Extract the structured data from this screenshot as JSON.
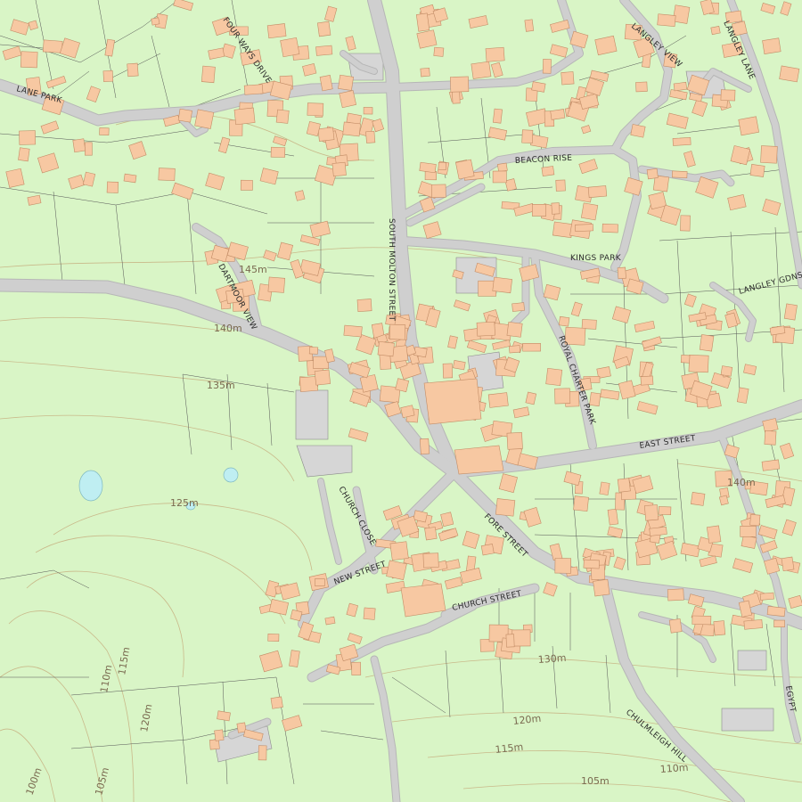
{
  "colors": {
    "land": "#d9f5c6",
    "road": "#cfcfcf",
    "building": "#f7c8a2",
    "building_outline": "#c28c66",
    "contour": "#c9b98a",
    "water": "#bfeef2",
    "grey_area": "#d6d6d6"
  },
  "road_labels": [
    {
      "id": "four-ways-drive",
      "text": "FOUR WAYS DRIVE"
    },
    {
      "id": "langley-view",
      "text": "LANGLEY VIEW"
    },
    {
      "id": "langley-lane",
      "text": "LANGLEY LANE"
    },
    {
      "id": "lane-park",
      "text": "LANE PARK"
    },
    {
      "id": "beacon-rise",
      "text": "BEACON RISE"
    },
    {
      "id": "kings-park",
      "text": "KINGS PARK"
    },
    {
      "id": "langley-gdns",
      "text": "LANGLEY GDNS"
    },
    {
      "id": "south-molton-street",
      "text": "SOUTH MOLTON STREET"
    },
    {
      "id": "dartmoor-view",
      "text": "DARTMOOR VIEW"
    },
    {
      "id": "royal-charter-park",
      "text": "ROYAL CHARTER PARK"
    },
    {
      "id": "east-street",
      "text": "EAST STREET"
    },
    {
      "id": "church-close",
      "text": "CHURCH CLOSE"
    },
    {
      "id": "fore-street",
      "text": "FORE STREET"
    },
    {
      "id": "new-street",
      "text": "NEW STREET"
    },
    {
      "id": "church-street",
      "text": "CHURCH STREET"
    },
    {
      "id": "chulmleigh-hill",
      "text": "CHULMLEIGH HILL"
    },
    {
      "id": "egypt",
      "text": "EGYPT"
    }
  ],
  "contour_labels": [
    {
      "id": "c145",
      "text": "145m"
    },
    {
      "id": "c140a",
      "text": "140m"
    },
    {
      "id": "c135",
      "text": "135m"
    },
    {
      "id": "c140b",
      "text": "140m"
    },
    {
      "id": "c125",
      "text": "125m"
    },
    {
      "id": "c130",
      "text": "130m"
    },
    {
      "id": "c120a",
      "text": "120m"
    },
    {
      "id": "c115a",
      "text": "115m"
    },
    {
      "id": "c110a",
      "text": "110m"
    },
    {
      "id": "c105a",
      "text": "105m"
    },
    {
      "id": "c115b",
      "text": "115m"
    },
    {
      "id": "c110b",
      "text": "110m"
    },
    {
      "id": "c120b",
      "text": "120m"
    },
    {
      "id": "c105b",
      "text": "105m"
    },
    {
      "id": "c100",
      "text": "100m"
    }
  ]
}
